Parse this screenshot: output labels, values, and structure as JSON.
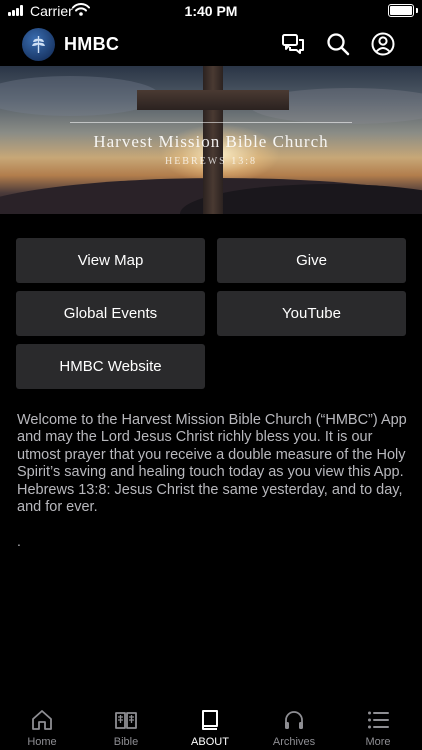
{
  "status_bar": {
    "carrier": "Carrier",
    "time": "1:40 PM"
  },
  "header": {
    "title": "HMBC",
    "icons": [
      "chat-icon",
      "search-icon",
      "profile-icon"
    ]
  },
  "banner": {
    "title": "Harvest Mission Bible Church",
    "subtitle": "HEBREWS 13:8"
  },
  "buttons": {
    "view_map": "View Map",
    "give": "Give",
    "global_events": "Global Events",
    "youtube": "YouTube",
    "website": "HMBC Website"
  },
  "welcome": {
    "text": "Welcome to the Harvest Mission Bible Church (“HMBC”) App and may the Lord Jesus Christ richly bless you. It is our utmost prayer that you receive a double measure of the Holy Spirit’s saving and healing touch today as you view this App. Hebrews 13:8: Jesus Christ the same yesterday, and to day, and for ever.",
    "trailing": "."
  },
  "tabs": [
    {
      "label": "Home",
      "icon": "home-icon"
    },
    {
      "label": "Bible",
      "icon": "bible-icon"
    },
    {
      "label": "ABOUT",
      "icon": "book-icon",
      "active": true
    },
    {
      "label": "Archives",
      "icon": "headphones-icon"
    },
    {
      "label": "More",
      "icon": "list-icon"
    }
  ],
  "colors": {
    "background": "#000000",
    "button_bg": "#2a2a2c",
    "body_text": "#b8b8bd",
    "tab_inactive": "#8e8e93"
  }
}
